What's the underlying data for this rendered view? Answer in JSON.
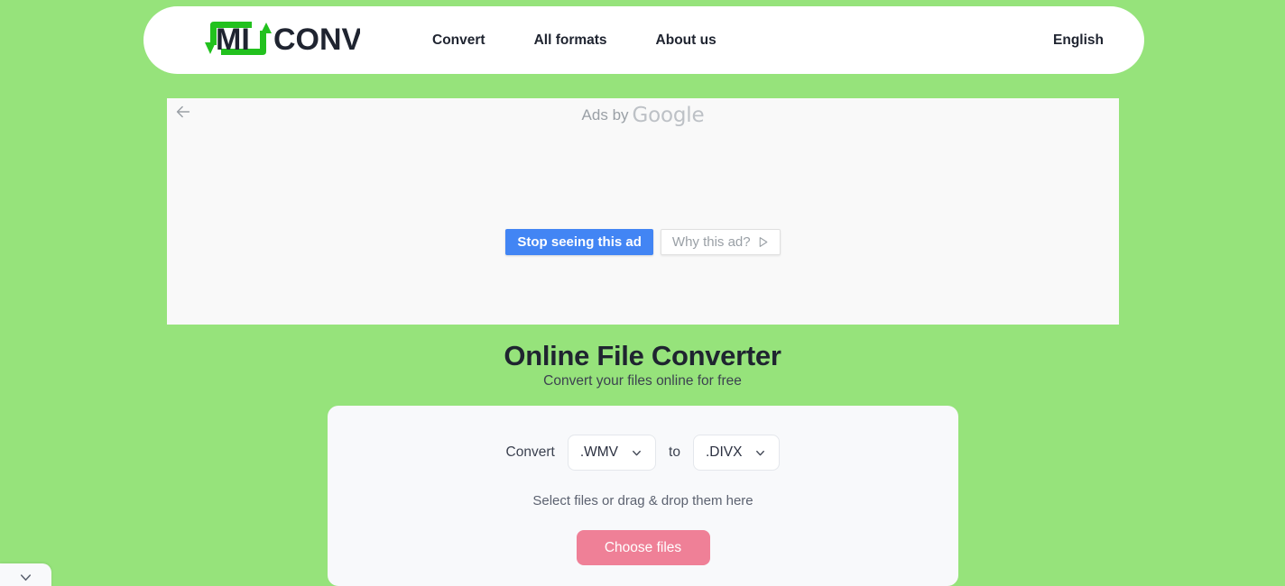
{
  "page": {
    "background_color": "#96e37b"
  },
  "header": {
    "logo": {
      "name": "miconv-logo",
      "text_dark": "CONV",
      "text_inner": "MI",
      "accent_color": "#22c11e"
    },
    "nav": [
      {
        "label": "Convert",
        "name": "nav-convert"
      },
      {
        "label": "All formats",
        "name": "nav-all-formats"
      },
      {
        "label": "About us",
        "name": "nav-about-us"
      }
    ],
    "language": "English"
  },
  "ad": {
    "back_icon": "arrow-left-icon",
    "ads_by_prefix": "Ads by",
    "ads_by_brand": "Google",
    "stop_button": "Stop seeing this ad",
    "why_button": "Why this ad?",
    "why_icon": "play-triangle-icon",
    "stop_button_color": "#4285f4"
  },
  "hero": {
    "title": "Online File Converter",
    "subtitle": "Convert your files online for free"
  },
  "converter": {
    "convert_label": "Convert",
    "to_label": "to",
    "source_format": ".WMV",
    "target_format": ".DIVX",
    "dropdown_icon": "chevron-down-icon",
    "drop_hint": "Select files or drag & drop them here",
    "choose_button": "Choose files",
    "choose_button_color": "#ef8097"
  },
  "bottom_tab": {
    "icon": "chevron-down-icon"
  }
}
